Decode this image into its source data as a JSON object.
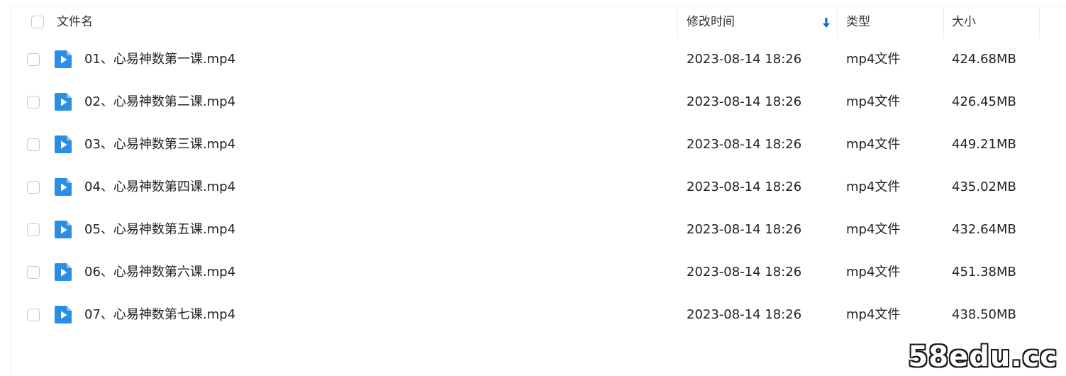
{
  "header": {
    "name": "文件名",
    "modified": "修改时间",
    "type": "类型",
    "size": "大小"
  },
  "files": [
    {
      "name": "01、心易神数第一课.mp4",
      "modified": "2023-08-14 18:26",
      "type": "mp4文件",
      "size": "424.68MB"
    },
    {
      "name": "02、心易神数第二课.mp4",
      "modified": "2023-08-14 18:26",
      "type": "mp4文件",
      "size": "426.45MB"
    },
    {
      "name": "03、心易神数第三课.mp4",
      "modified": "2023-08-14 18:26",
      "type": "mp4文件",
      "size": "449.21MB"
    },
    {
      "name": "04、心易神数第四课.mp4",
      "modified": "2023-08-14 18:26",
      "type": "mp4文件",
      "size": "435.02MB"
    },
    {
      "name": "05、心易神数第五课.mp4",
      "modified": "2023-08-14 18:26",
      "type": "mp4文件",
      "size": "432.64MB"
    },
    {
      "name": "06、心易神数第六课.mp4",
      "modified": "2023-08-14 18:26",
      "type": "mp4文件",
      "size": "451.38MB"
    },
    {
      "name": "07、心易神数第七课.mp4",
      "modified": "2023-08-14 18:26",
      "type": "mp4文件",
      "size": "438.50MB"
    }
  ],
  "icons": {
    "sort": "sort-descending-icon",
    "file": "video-file-icon"
  },
  "colors": {
    "accent": "#0d6dd8",
    "file_icon": "#2b8de3"
  },
  "watermark": "58edu.cc"
}
